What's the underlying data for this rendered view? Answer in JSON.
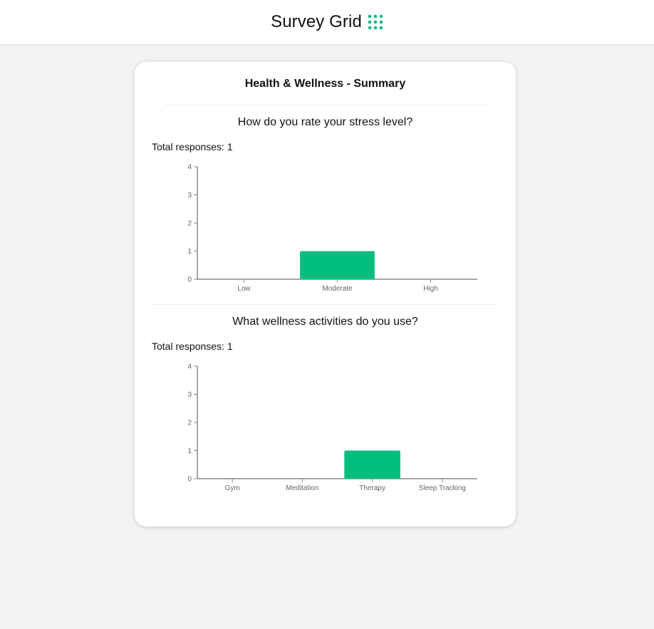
{
  "header": {
    "title": "Survey Grid",
    "icon": "grid-dots-icon",
    "accent_color": "#10b981"
  },
  "summary": {
    "title": "Health & Wellness - Summary",
    "questions": [
      {
        "title": "How do you rate your stress level?",
        "total_label": "Total responses: 1"
      },
      {
        "title": "What wellness activities do you use?",
        "total_label": "Total responses: 1"
      }
    ]
  },
  "chart_data": [
    {
      "type": "bar",
      "categories": [
        "Low",
        "Moderate",
        "High"
      ],
      "values": [
        0,
        1,
        0
      ],
      "ylim": [
        0,
        4
      ],
      "yticks": [
        0,
        1,
        2,
        3,
        4
      ],
      "bar_color": "#00bf7d",
      "grid": false
    },
    {
      "type": "bar",
      "categories": [
        "Gym",
        "Meditation",
        "Therapy",
        "Sleep Tracking"
      ],
      "values": [
        0,
        0,
        1,
        0
      ],
      "ylim": [
        0,
        4
      ],
      "yticks": [
        0,
        1,
        2,
        3,
        4
      ],
      "bar_color": "#00bf7d",
      "grid": false
    }
  ]
}
